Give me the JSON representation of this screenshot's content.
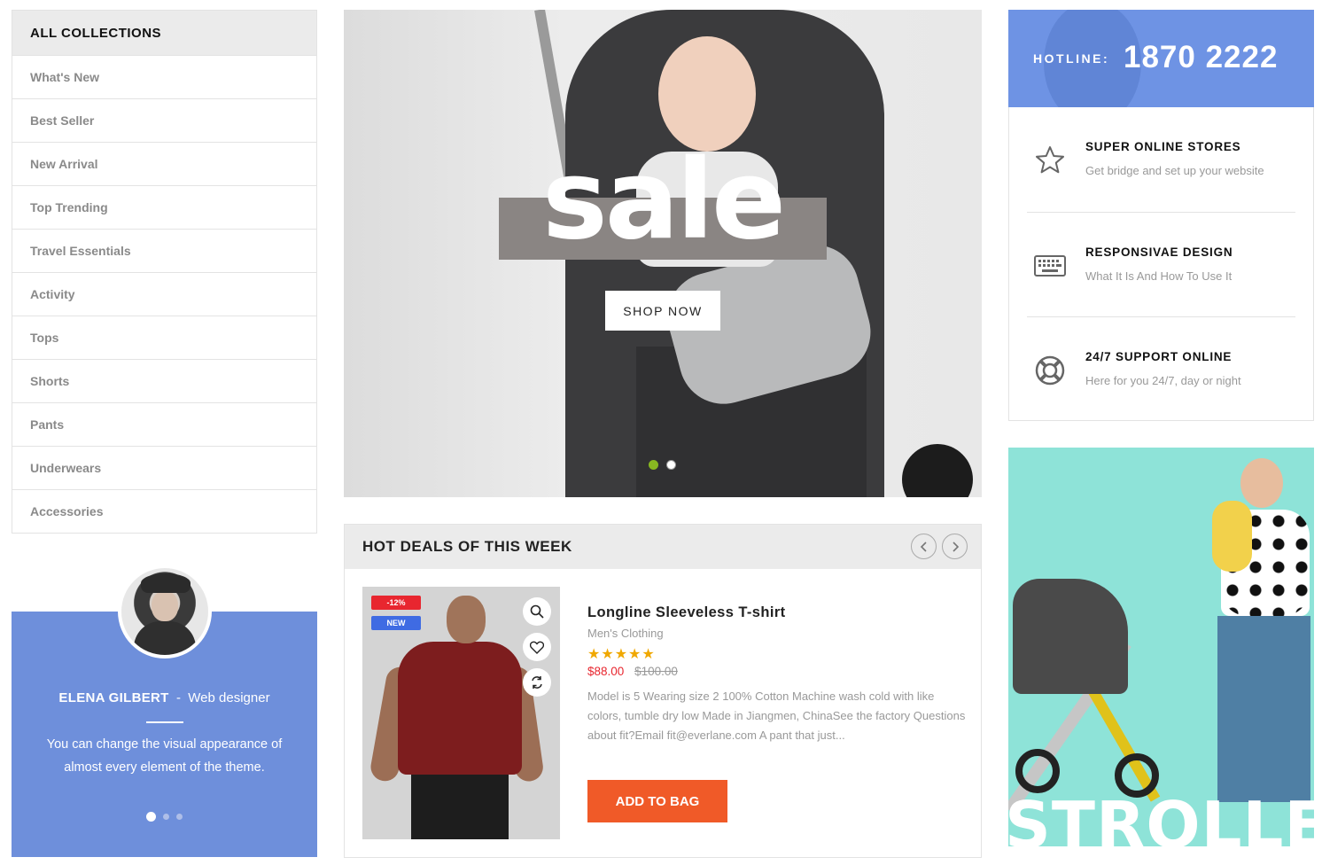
{
  "collections": {
    "title": "ALL COLLECTIONS",
    "items": [
      {
        "label": "What's New"
      },
      {
        "label": "Best Seller"
      },
      {
        "label": "New Arrival"
      },
      {
        "label": "Top Trending"
      },
      {
        "label": "Travel Essentials"
      },
      {
        "label": "Activity"
      },
      {
        "label": "Tops"
      },
      {
        "label": "Shorts"
      },
      {
        "label": "Pants"
      },
      {
        "label": "Underwears"
      },
      {
        "label": "Accessories"
      }
    ]
  },
  "testimonial": {
    "name": "ELENA GILBERT",
    "separator": "-",
    "role": "Web designer",
    "quote": "You can change the visual appearance of almost every element of the theme.",
    "active_slide": 1,
    "slide_count": 3,
    "bg_color": "#6e8fdb"
  },
  "hero": {
    "headline": "sale",
    "cta": "SHOP NOW",
    "slide_count": 2,
    "active_slide": 1,
    "accent_color": "#88b821"
  },
  "deals": {
    "title": "HOT DEALS OF THIS WEEK",
    "prev_icon": "chevron-left-icon",
    "next_icon": "chevron-right-icon",
    "product": {
      "badge_sale": "-12%",
      "badge_new": "NEW",
      "title": "Longline Sleeveless T-shirt",
      "category": "Men's Clothing",
      "rating": 5,
      "stars": "★★★★★",
      "price": "$88.00",
      "old_price": "$100.00",
      "description": "Model is 5 Wearing size 2 100% Cotton Machine wash cold with like colors, tumble dry low Made in Jiangmen, ChinaSee the factory Questions about fit?Email fit@everlane.com A pant that just...",
      "add_to_bag": "ADD TO BAG",
      "actions": [
        "search-icon",
        "heart-icon",
        "compare-icon"
      ]
    },
    "button_color": "#f05a28"
  },
  "hotline": {
    "label": "HOTLINE:",
    "number": "1870 2222",
    "bg_color": "#6e93e4"
  },
  "services": [
    {
      "icon": "star-icon",
      "title": "SUPER ONLINE STORES",
      "subtitle": "Get bridge and set up your website"
    },
    {
      "icon": "keyboard-icon",
      "title": "RESPONSIVAE DESIGN",
      "subtitle": "What It Is And How To Use It"
    },
    {
      "icon": "lifebuoy-icon",
      "title": "24/7 SUPPORT ONLINE",
      "subtitle": "Here for you 24/7, day or night"
    }
  ],
  "promo": {
    "word": "STROLLER",
    "bg_color": "#8ee3d8"
  }
}
